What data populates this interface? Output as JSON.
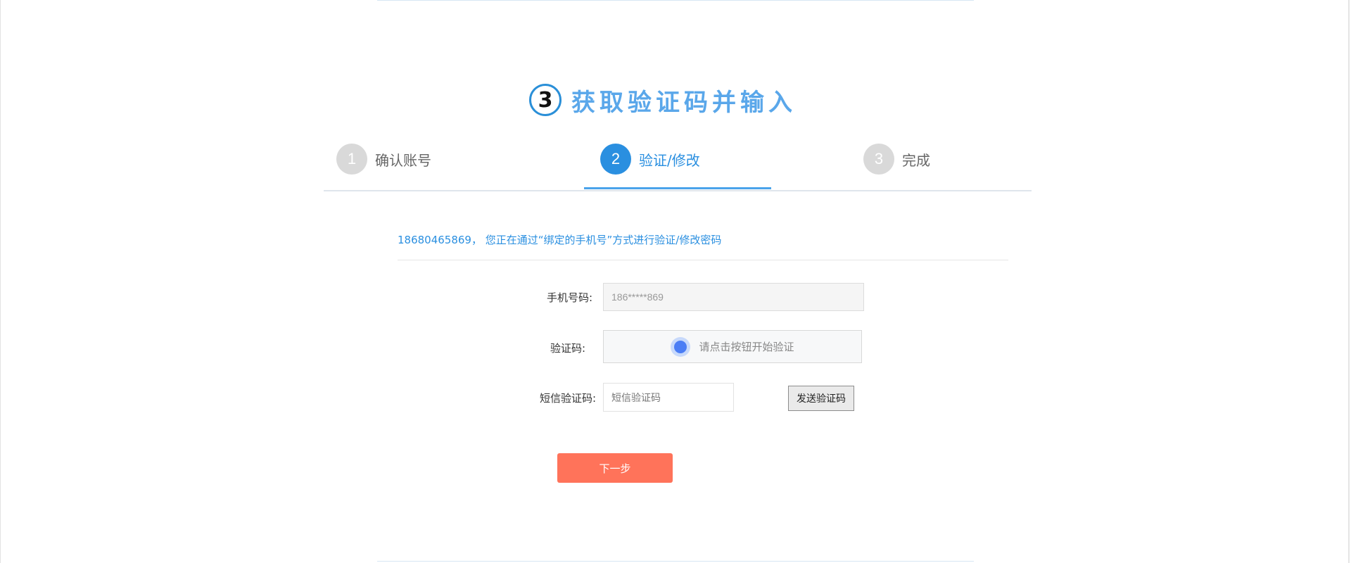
{
  "heading": {
    "number": "3",
    "title": "获取验证码并输入"
  },
  "steps": [
    {
      "number": "1",
      "label": "确认账号",
      "active": false
    },
    {
      "number": "2",
      "label": "验证/修改",
      "active": true
    },
    {
      "number": "3",
      "label": "完成",
      "active": false
    }
  ],
  "info": {
    "text": "18680465869， 您正在通过“绑定的手机号”方式进行验证/修改密码"
  },
  "form": {
    "phone_label": "手机号码:",
    "phone_value": "186*****869",
    "captcha_label": "验证码:",
    "captcha_prompt": "请点击按钮开始验证",
    "sms_label": "短信验证码:",
    "sms_placeholder": "短信验证码",
    "send_button": "发送验证码",
    "next_button": "下一步"
  },
  "colors": {
    "accent": "#2a8fe0",
    "heading": "#5aa7ea",
    "next_button": "#ff735a",
    "inactive_step": "#d9d9d9"
  }
}
